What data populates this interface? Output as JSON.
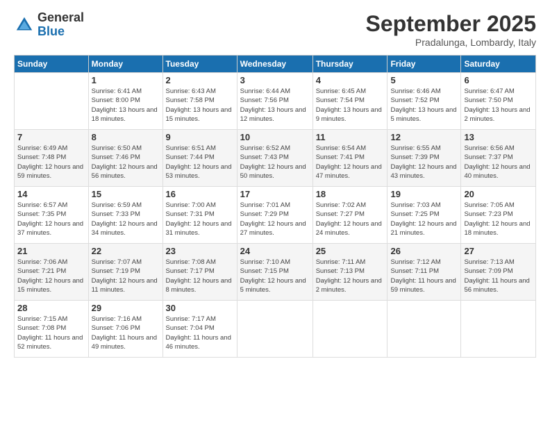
{
  "logo": {
    "general": "General",
    "blue": "Blue"
  },
  "header": {
    "month": "September 2025",
    "location": "Pradalunga, Lombardy, Italy"
  },
  "weekdays": [
    "Sunday",
    "Monday",
    "Tuesday",
    "Wednesday",
    "Thursday",
    "Friday",
    "Saturday"
  ],
  "weeks": [
    [
      {
        "day": "",
        "sunrise": "",
        "sunset": "",
        "daylight": ""
      },
      {
        "day": "1",
        "sunrise": "Sunrise: 6:41 AM",
        "sunset": "Sunset: 8:00 PM",
        "daylight": "Daylight: 13 hours and 18 minutes."
      },
      {
        "day": "2",
        "sunrise": "Sunrise: 6:43 AM",
        "sunset": "Sunset: 7:58 PM",
        "daylight": "Daylight: 13 hours and 15 minutes."
      },
      {
        "day": "3",
        "sunrise": "Sunrise: 6:44 AM",
        "sunset": "Sunset: 7:56 PM",
        "daylight": "Daylight: 13 hours and 12 minutes."
      },
      {
        "day": "4",
        "sunrise": "Sunrise: 6:45 AM",
        "sunset": "Sunset: 7:54 PM",
        "daylight": "Daylight: 13 hours and 9 minutes."
      },
      {
        "day": "5",
        "sunrise": "Sunrise: 6:46 AM",
        "sunset": "Sunset: 7:52 PM",
        "daylight": "Daylight: 13 hours and 5 minutes."
      },
      {
        "day": "6",
        "sunrise": "Sunrise: 6:47 AM",
        "sunset": "Sunset: 7:50 PM",
        "daylight": "Daylight: 13 hours and 2 minutes."
      }
    ],
    [
      {
        "day": "7",
        "sunrise": "Sunrise: 6:49 AM",
        "sunset": "Sunset: 7:48 PM",
        "daylight": "Daylight: 12 hours and 59 minutes."
      },
      {
        "day": "8",
        "sunrise": "Sunrise: 6:50 AM",
        "sunset": "Sunset: 7:46 PM",
        "daylight": "Daylight: 12 hours and 56 minutes."
      },
      {
        "day": "9",
        "sunrise": "Sunrise: 6:51 AM",
        "sunset": "Sunset: 7:44 PM",
        "daylight": "Daylight: 12 hours and 53 minutes."
      },
      {
        "day": "10",
        "sunrise": "Sunrise: 6:52 AM",
        "sunset": "Sunset: 7:43 PM",
        "daylight": "Daylight: 12 hours and 50 minutes."
      },
      {
        "day": "11",
        "sunrise": "Sunrise: 6:54 AM",
        "sunset": "Sunset: 7:41 PM",
        "daylight": "Daylight: 12 hours and 47 minutes."
      },
      {
        "day": "12",
        "sunrise": "Sunrise: 6:55 AM",
        "sunset": "Sunset: 7:39 PM",
        "daylight": "Daylight: 12 hours and 43 minutes."
      },
      {
        "day": "13",
        "sunrise": "Sunrise: 6:56 AM",
        "sunset": "Sunset: 7:37 PM",
        "daylight": "Daylight: 12 hours and 40 minutes."
      }
    ],
    [
      {
        "day": "14",
        "sunrise": "Sunrise: 6:57 AM",
        "sunset": "Sunset: 7:35 PM",
        "daylight": "Daylight: 12 hours and 37 minutes."
      },
      {
        "day": "15",
        "sunrise": "Sunrise: 6:59 AM",
        "sunset": "Sunset: 7:33 PM",
        "daylight": "Daylight: 12 hours and 34 minutes."
      },
      {
        "day": "16",
        "sunrise": "Sunrise: 7:00 AM",
        "sunset": "Sunset: 7:31 PM",
        "daylight": "Daylight: 12 hours and 31 minutes."
      },
      {
        "day": "17",
        "sunrise": "Sunrise: 7:01 AM",
        "sunset": "Sunset: 7:29 PM",
        "daylight": "Daylight: 12 hours and 27 minutes."
      },
      {
        "day": "18",
        "sunrise": "Sunrise: 7:02 AM",
        "sunset": "Sunset: 7:27 PM",
        "daylight": "Daylight: 12 hours and 24 minutes."
      },
      {
        "day": "19",
        "sunrise": "Sunrise: 7:03 AM",
        "sunset": "Sunset: 7:25 PM",
        "daylight": "Daylight: 12 hours and 21 minutes."
      },
      {
        "day": "20",
        "sunrise": "Sunrise: 7:05 AM",
        "sunset": "Sunset: 7:23 PM",
        "daylight": "Daylight: 12 hours and 18 minutes."
      }
    ],
    [
      {
        "day": "21",
        "sunrise": "Sunrise: 7:06 AM",
        "sunset": "Sunset: 7:21 PM",
        "daylight": "Daylight: 12 hours and 15 minutes."
      },
      {
        "day": "22",
        "sunrise": "Sunrise: 7:07 AM",
        "sunset": "Sunset: 7:19 PM",
        "daylight": "Daylight: 12 hours and 11 minutes."
      },
      {
        "day": "23",
        "sunrise": "Sunrise: 7:08 AM",
        "sunset": "Sunset: 7:17 PM",
        "daylight": "Daylight: 12 hours and 8 minutes."
      },
      {
        "day": "24",
        "sunrise": "Sunrise: 7:10 AM",
        "sunset": "Sunset: 7:15 PM",
        "daylight": "Daylight: 12 hours and 5 minutes."
      },
      {
        "day": "25",
        "sunrise": "Sunrise: 7:11 AM",
        "sunset": "Sunset: 7:13 PM",
        "daylight": "Daylight: 12 hours and 2 minutes."
      },
      {
        "day": "26",
        "sunrise": "Sunrise: 7:12 AM",
        "sunset": "Sunset: 7:11 PM",
        "daylight": "Daylight: 11 hours and 59 minutes."
      },
      {
        "day": "27",
        "sunrise": "Sunrise: 7:13 AM",
        "sunset": "Sunset: 7:09 PM",
        "daylight": "Daylight: 11 hours and 56 minutes."
      }
    ],
    [
      {
        "day": "28",
        "sunrise": "Sunrise: 7:15 AM",
        "sunset": "Sunset: 7:08 PM",
        "daylight": "Daylight: 11 hours and 52 minutes."
      },
      {
        "day": "29",
        "sunrise": "Sunrise: 7:16 AM",
        "sunset": "Sunset: 7:06 PM",
        "daylight": "Daylight: 11 hours and 49 minutes."
      },
      {
        "day": "30",
        "sunrise": "Sunrise: 7:17 AM",
        "sunset": "Sunset: 7:04 PM",
        "daylight": "Daylight: 11 hours and 46 minutes."
      },
      {
        "day": "",
        "sunrise": "",
        "sunset": "",
        "daylight": ""
      },
      {
        "day": "",
        "sunrise": "",
        "sunset": "",
        "daylight": ""
      },
      {
        "day": "",
        "sunrise": "",
        "sunset": "",
        "daylight": ""
      },
      {
        "day": "",
        "sunrise": "",
        "sunset": "",
        "daylight": ""
      }
    ]
  ]
}
